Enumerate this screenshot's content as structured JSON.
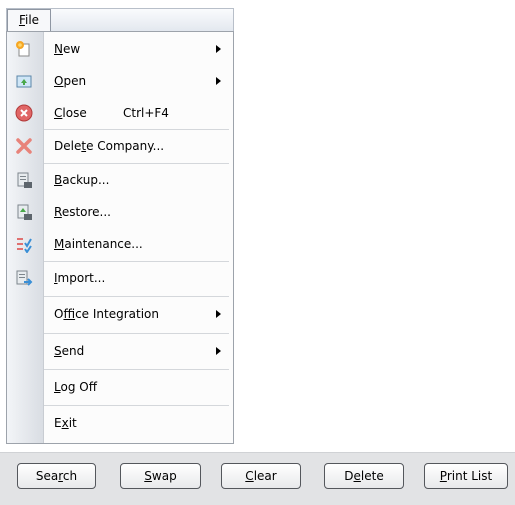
{
  "menubar": {
    "file": {
      "before": "",
      "key": "F",
      "after": "ile"
    }
  },
  "menu": {
    "items": [
      {
        "before": "",
        "key": "N",
        "after": "ew",
        "shortcut": "",
        "submenu": true,
        "icon": "new-document-icon"
      },
      {
        "before": "",
        "key": "O",
        "after": "pen",
        "shortcut": "",
        "submenu": true,
        "icon": "open-folder-icon"
      },
      {
        "before": "",
        "key": "C",
        "after": "lose",
        "shortcut": "Ctrl+F4",
        "submenu": false,
        "icon": "close-circle-icon"
      },
      {
        "before": "Dele",
        "key": "t",
        "after": "e Company...",
        "shortcut": "",
        "submenu": false,
        "icon": "delete-x-icon"
      },
      {
        "before": "",
        "key": "B",
        "after": "ackup...",
        "shortcut": "",
        "submenu": false,
        "icon": "backup-icon"
      },
      {
        "before": "",
        "key": "R",
        "after": "estore...",
        "shortcut": "",
        "submenu": false,
        "icon": "restore-icon"
      },
      {
        "before": "",
        "key": "M",
        "after": "aintenance...",
        "shortcut": "",
        "submenu": false,
        "icon": "maintenance-icon"
      },
      {
        "before": "",
        "key": "I",
        "after": "mport...",
        "shortcut": "",
        "submenu": false,
        "icon": "import-icon"
      },
      {
        "before": "O",
        "key": "f",
        "after": "fice Integration",
        "shortcut": "",
        "submenu": true,
        "icon": ""
      },
      {
        "before": "",
        "key": "S",
        "after": "end",
        "shortcut": "",
        "submenu": true,
        "icon": ""
      },
      {
        "before": "",
        "key": "L",
        "after": "og Off",
        "shortcut": "",
        "submenu": false,
        "icon": ""
      },
      {
        "before": "E",
        "key": "x",
        "after": "it",
        "shortcut": "",
        "submenu": false,
        "icon": ""
      }
    ]
  },
  "toolbar": {
    "buttons": [
      {
        "before": "Sea",
        "key": "r",
        "after": "ch"
      },
      {
        "before": "",
        "key": "S",
        "after": "wap"
      },
      {
        "before": "",
        "key": "C",
        "after": "lear"
      },
      {
        "before": "D",
        "key": "e",
        "after": "lete"
      },
      {
        "before": "",
        "key": "P",
        "after": "rint List"
      }
    ]
  }
}
